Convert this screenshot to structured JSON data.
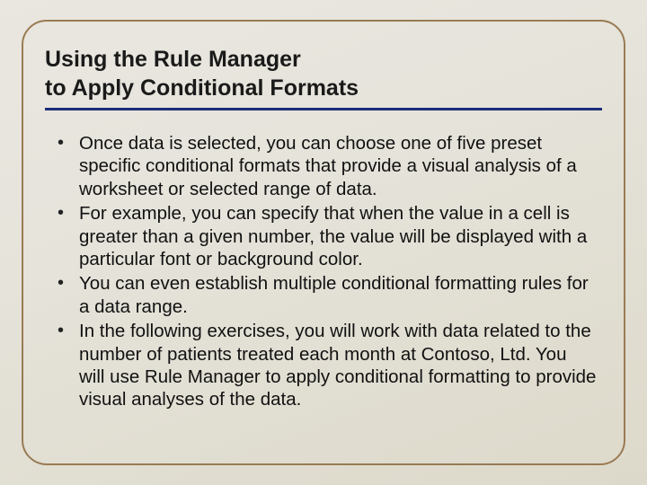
{
  "title_line1": "Using the Rule Manager",
  "title_line2": "to Apply Conditional Formats",
  "bullets": [
    "Once data is selected, you can choose one of five preset specific conditional formats that provide a visual analysis of a worksheet or selected range of data.",
    "For example, you can specify that when the value in a cell is greater than a given number, the value will be displayed with a particular font or background color.",
    "You can even establish multiple conditional formatting rules for a data range.",
    "In the following exercises, you will work with data related to the number of patients treated each month at Contoso, Ltd. You will use Rule Manager to apply conditional formatting to provide visual analyses of the data."
  ]
}
